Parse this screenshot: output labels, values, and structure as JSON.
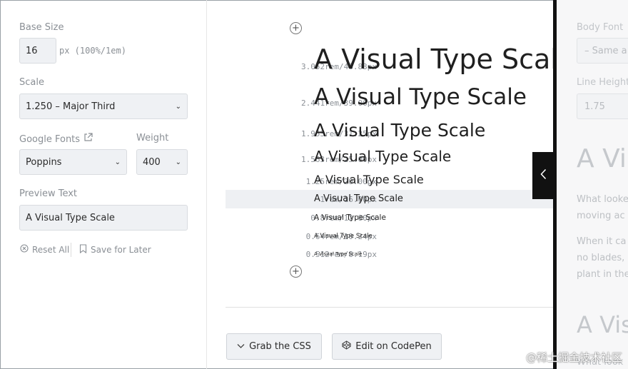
{
  "controls": {
    "base_size_label": "Base Size",
    "base_size_value": "16",
    "base_size_unit": "px (100%/1em)",
    "scale_label": "Scale",
    "scale_value": "1.250 – Major Third",
    "google_fonts_label": "Google Fonts",
    "font_value": "Poppins",
    "weight_label": "Weight",
    "weight_value": "400",
    "preview_text_label": "Preview Text",
    "preview_text_value": "A Visual Type Scale",
    "reset_label": "Reset All",
    "save_label": "Save for Later"
  },
  "scale_rows": [
    {
      "size": "3.052rem/48.83px",
      "text": "A Visual Type Scale"
    },
    {
      "size": "2.441rem/39.06px",
      "text": "A Visual Type Scale"
    },
    {
      "size": "1.953rem/31.25px",
      "text": "A Visual Type Scale"
    },
    {
      "size": "1.563rem/25.00px",
      "text": "A Visual Type Scale"
    },
    {
      "size": "1.25rem/20.00px",
      "text": "A Visual Type Scale"
    },
    {
      "size": "1rem/16.00px",
      "text": "A Visual Type Scale"
    },
    {
      "size": "0.8rem/12.80px",
      "text": "A Visual Type Scale"
    },
    {
      "size": "0.64rem/10.24px",
      "text": "A Visual Type Scale"
    },
    {
      "size": "0.512rem/8.19px",
      "text": "A Visual Type Scale"
    }
  ],
  "actions": {
    "grab_css": "Grab the CSS",
    "edit_codepen": "Edit on CodePen"
  },
  "side_panel": {
    "body_font_label": "Body Font",
    "body_font_value": "– Same a",
    "line_height_label": "Line Height",
    "line_height_value": "1.75",
    "preview_heading": "A Vi",
    "para1_line1": "What looke",
    "para1_line2": "moving ac",
    "para2_line1": "When it ca",
    "para2_line2": "no blades,",
    "para2_line3": "plant in the",
    "preview_heading_2": "A Vis",
    "bottom_cut": "What look"
  },
  "watermark": "@稀土掘金技术社区",
  "icons": {
    "add": "plus-circle-icon",
    "external": "external-link-icon",
    "reset": "reset-circle-icon",
    "save": "bookmark-icon",
    "chevron": "chevron-down-icon",
    "codepen": "codepen-icon",
    "toggle": "chevron-left-icon"
  }
}
